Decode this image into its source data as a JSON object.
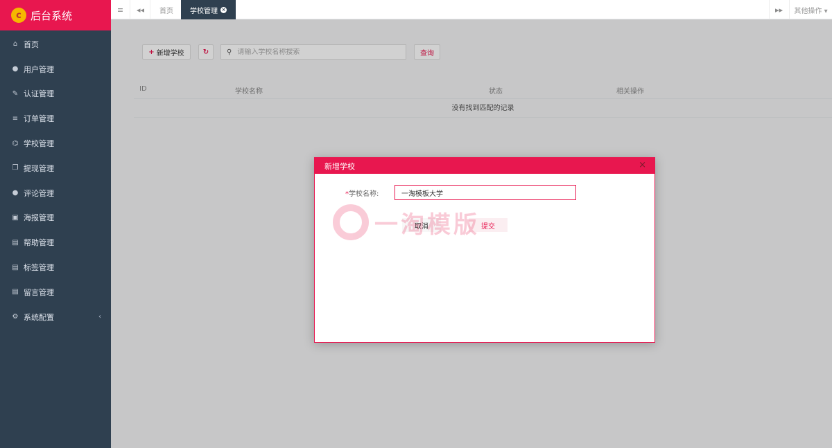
{
  "app": {
    "title": "后台系统",
    "logo_glyph": "c"
  },
  "sidebar": {
    "items": [
      {
        "label": "首页",
        "icon": "home-icon",
        "glyph": "⌂"
      },
      {
        "label": "用户管理",
        "icon": "user-icon",
        "glyph": "●"
      },
      {
        "label": "认证管理",
        "icon": "wrench-icon",
        "glyph": "✎"
      },
      {
        "label": "订单管理",
        "icon": "list-icon",
        "glyph": "≡"
      },
      {
        "label": "学校管理",
        "icon": "bank-icon",
        "glyph": "⌬"
      },
      {
        "label": "提现管理",
        "icon": "copy-icon",
        "glyph": "❐"
      },
      {
        "label": "评论管理",
        "icon": "comment-icon",
        "glyph": "●"
      },
      {
        "label": "海报管理",
        "icon": "image-icon",
        "glyph": "▣"
      },
      {
        "label": "帮助管理",
        "icon": "file-icon",
        "glyph": "▤"
      },
      {
        "label": "标签管理",
        "icon": "file-icon",
        "glyph": "▤"
      },
      {
        "label": "留言管理",
        "icon": "file-icon",
        "glyph": "▤"
      },
      {
        "label": "系统配置",
        "icon": "cogs-icon",
        "glyph": "⚙",
        "caret": "‹"
      }
    ]
  },
  "topbar": {
    "menu_glyph": "≡",
    "back_glyph": "◂◂",
    "forward_glyph": "▸▸",
    "tabs": [
      {
        "label": "首页",
        "active": false
      },
      {
        "label": "学校管理",
        "active": true,
        "close_glyph": "×"
      }
    ],
    "other_ops": "其他操作 ▾"
  },
  "toolbar": {
    "add_label": "新增学校",
    "add_glyph": "+",
    "refresh_glyph": "↻",
    "search_glyph": "⚲",
    "search_placeholder": "请输入学校名称搜索",
    "query_label": "查询"
  },
  "table": {
    "columns": [
      "ID",
      "学校名称",
      "状态",
      "相关操作"
    ],
    "empty_text": "没有找到匹配的记录"
  },
  "modal": {
    "title": "新增学校",
    "close_glyph": "×",
    "field_required": "*",
    "field_label": "学校名称:",
    "field_value": "一淘模板大学",
    "cancel_label": "取消",
    "submit_label": "提交"
  },
  "watermark": {
    "text": "一淘模版"
  },
  "colors": {
    "brand": "#e8174f",
    "sidebar": "#2f4050"
  }
}
